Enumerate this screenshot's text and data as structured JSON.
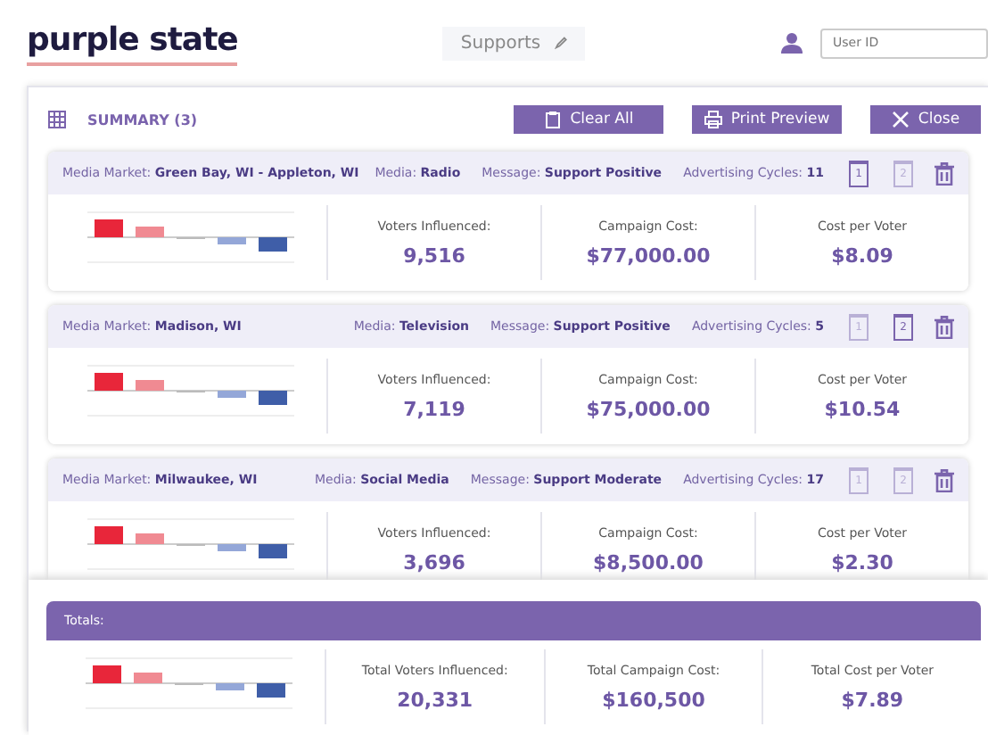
{
  "header": {
    "logo": "purple state",
    "page_title": "Supports",
    "user_field": {
      "placeholder": "User ID"
    }
  },
  "summary": {
    "title": "SUMMARY",
    "count": "(3)",
    "buttons": [
      {
        "kind": "clear",
        "label": "Clear All"
      },
      {
        "kind": "print",
        "label": "Print Preview"
      },
      {
        "kind": "close",
        "label": "Close"
      }
    ]
  },
  "cards": [
    {
      "market_label": "Media Market:",
      "market": "Green Bay, WI - Appleton, WI",
      "media_label": "Media:",
      "media": "Radio",
      "message_label": "Message:",
      "message": "Support Positive",
      "cycles_label": "Advertising Cycles:",
      "cycles": "11",
      "pages": [
        {
          "label": "1",
          "selected": true
        },
        {
          "label": "2",
          "selected": false
        }
      ],
      "stats": [
        {
          "label": "Voters Influenced:",
          "value": "9,516"
        },
        {
          "label": "Campaign Cost:",
          "value": "$77,000.00"
        },
        {
          "label": "Cost per Voter",
          "value": "$8.09"
        }
      ]
    },
    {
      "market_label": "Media Market:",
      "market": "Madison, WI",
      "media_label": "Media:",
      "media": "Television",
      "message_label": "Message:",
      "message": "Support Positive",
      "cycles_label": "Advertising Cycles:",
      "cycles": "5",
      "pages": [
        {
          "label": "1",
          "selected": false
        },
        {
          "label": "2",
          "selected": true
        }
      ],
      "stats": [
        {
          "label": "Voters Influenced:",
          "value": "7,119"
        },
        {
          "label": "Campaign Cost:",
          "value": "$75,000.00"
        },
        {
          "label": "Cost per Voter",
          "value": "$10.54"
        }
      ]
    },
    {
      "market_label": "Media Market:",
      "market": "Milwaukee, WI",
      "media_label": "Media:",
      "media": "Social Media",
      "message_label": "Message:",
      "message": "Support Moderate",
      "cycles_label": "Advertising Cycles:",
      "cycles": "17",
      "pages": [
        {
          "label": "1",
          "selected": false
        },
        {
          "label": "2",
          "selected": false
        }
      ],
      "stats": [
        {
          "label": "Voters Influenced:",
          "value": "3,696"
        },
        {
          "label": "Campaign Cost:",
          "value": "$8,500.00"
        },
        {
          "label": "Cost per Voter",
          "value": "$2.30"
        }
      ]
    }
  ],
  "totals": {
    "title": "Totals:",
    "stats": [
      {
        "label": "Total Voters Influenced:",
        "value": "20,331"
      },
      {
        "label": "Total Campaign Cost:",
        "value": "$160,500"
      },
      {
        "label": "Total Cost per Voter",
        "value": "$7.89"
      }
    ]
  }
}
